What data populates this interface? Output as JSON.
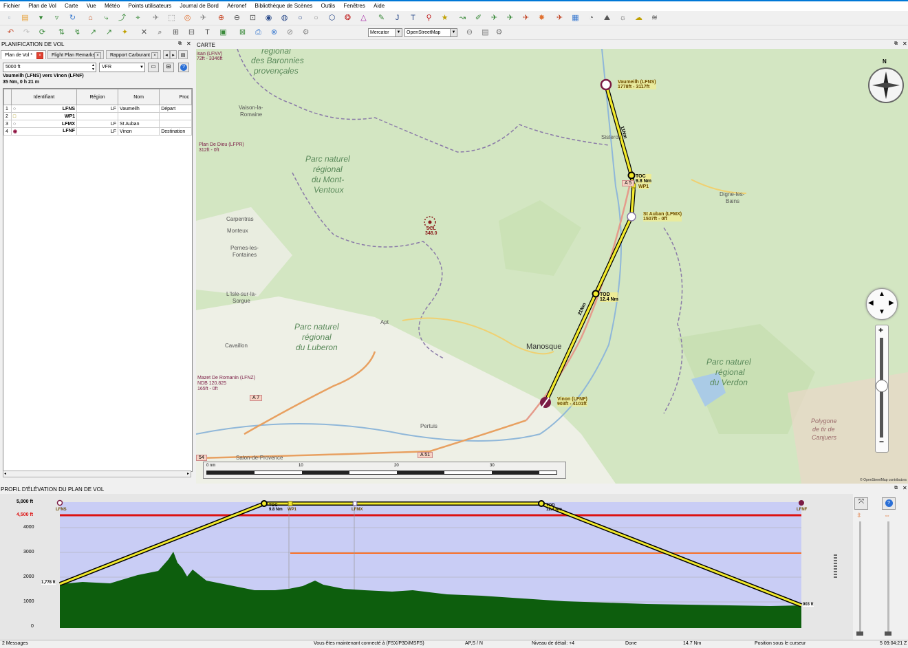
{
  "menu": [
    "Fichier",
    "Plan de Vol",
    "Carte",
    "Vue",
    "Météo",
    "Points utilisateurs",
    "Journal de Bord",
    "Aéronef",
    "Bibliothèque de Scènes",
    "Outils",
    "Fenêtres",
    "Aide"
  ],
  "toolbar": {
    "projection": "Mercator",
    "map_theme": "OpenStreetMap"
  },
  "left_panel": {
    "title": "PLANIFICATION DE VOL",
    "tabs": [
      "Plan de Vol *",
      "Flight Plan Remarks",
      "Rapport Carburant"
    ],
    "altitude": "5000 ft",
    "flight_rules": "VFR",
    "route_title": "Vaumeilh (LFNS) vers Vinon (LFNF)",
    "route_summary": "35 Nm, 0 h 21 m",
    "columns": [
      "Identifiant",
      "Région",
      "Nom",
      "Proc"
    ],
    "rows": [
      {
        "n": "1",
        "id": "LFNS",
        "region": "LF",
        "name": "Vaumeilh",
        "proc": "Départ"
      },
      {
        "n": "2",
        "id": "WP1",
        "region": "",
        "name": "",
        "proc": ""
      },
      {
        "n": "3",
        "id": "LFMX",
        "region": "LF",
        "name": "St Auban",
        "proc": ""
      },
      {
        "n": "4",
        "id": "LFNF",
        "region": "LF",
        "name": "Vinon",
        "proc": "Destination"
      }
    ]
  },
  "map": {
    "title": "CARTE",
    "places": [
      {
        "t": "régional"
      },
      {
        "t": "des Baronnies"
      },
      {
        "t": "provençales"
      },
      {
        "t": "Vaison-la-"
      },
      {
        "t": "Romaine"
      },
      {
        "t": "Plan De Dieu (LFPR)"
      },
      {
        "t": "312ft - 0ft"
      },
      {
        "t": "Parc naturel"
      },
      {
        "t": "régional"
      },
      {
        "t": "du Mont-"
      },
      {
        "t": "Ventoux"
      },
      {
        "t": "Carpentras"
      },
      {
        "t": "Monteux"
      },
      {
        "t": "Pernes-les-"
      },
      {
        "t": "Fontaines"
      },
      {
        "t": "L'Isle-sur-la-"
      },
      {
        "t": "Sorgue"
      },
      {
        "t": "Parc naturel"
      },
      {
        "t": "régional"
      },
      {
        "t": "du Luberon"
      },
      {
        "t": "Apt"
      },
      {
        "t": "Cavaillon"
      },
      {
        "t": "Mazet De Romanin (LFNZ)"
      },
      {
        "t": "NDB 120.825"
      },
      {
        "t": "165ft - 0ft"
      },
      {
        "t": "Pertuis"
      },
      {
        "t": "Salon-de-Provence"
      },
      {
        "t": "Manosque"
      },
      {
        "t": "Sisteron"
      },
      {
        "t": "Digne-les-"
      },
      {
        "t": "Bains"
      },
      {
        "t": "Parc naturel"
      },
      {
        "t": "régional"
      },
      {
        "t": "du Verdon"
      },
      {
        "t": "Polygone"
      },
      {
        "t": "de tir de"
      },
      {
        "t": "Canjuers"
      },
      {
        "t": "isan (LFNV)"
      },
      {
        "t": "72ft - 3346ft"
      }
    ],
    "roads": [
      "A 7",
      "A 51",
      "A 5",
      "54"
    ],
    "waypoints": [
      {
        "name": "Vaumeilh (LFNS)",
        "info": "1778ft - 3117ft"
      },
      {
        "name": "TOC",
        "info": "9.8 Nm"
      },
      {
        "name": "WP1",
        "info": ""
      },
      {
        "name": "St Auban (LFMX)",
        "info": "1507ft - 0ft"
      },
      {
        "name": "TOD",
        "info": "12.4 Nm"
      },
      {
        "name": "Vinon (LFNF)",
        "info": "903ft - 4101ft"
      }
    ],
    "leg_labels": [
      "11Nm",
      "21Nm"
    ],
    "vor": {
      "name": "SCL",
      "freq": "348.0"
    },
    "scale": [
      "0 nm",
      "10",
      "20",
      "30"
    ],
    "attribution": "© OpenStreetMap contributors",
    "compass": "N"
  },
  "profile": {
    "title": "PROFIL D'ÉLÉVATION DU PLAN DE VOL",
    "y_labels": [
      "5,000 ft",
      "4,500 ft",
      "4000",
      "3000",
      "2000",
      "1000",
      "0"
    ],
    "waypoints": [
      "LFNS",
      "TOC",
      "WP1",
      "LFMX",
      "TOD",
      "LFNF"
    ],
    "toc_dist": "9.8 Nm",
    "tod_dist": "12.4 Nm",
    "start_alt": "1,778 ft",
    "end_alt": "903 ft"
  },
  "status": {
    "messages": "2 Messages",
    "connection": "Vous êtes maintenant connecté à (FSX/P3D/MSFS)",
    "ap": "AP,S / N",
    "detail": "Niveau de détail: +4",
    "done": "Done",
    "distance": "14.7 Nm",
    "cursor": "Position sous le curseur",
    "time": "5 09:04:21 Z"
  },
  "colors": {
    "route": "#f2ea2c",
    "alt_line": "#dd1111",
    "safe_alt": "#ff6a1a",
    "terrain": "#0d5e0d",
    "sky": "#c9cdf5",
    "map_bg": "#d6e8c5"
  }
}
